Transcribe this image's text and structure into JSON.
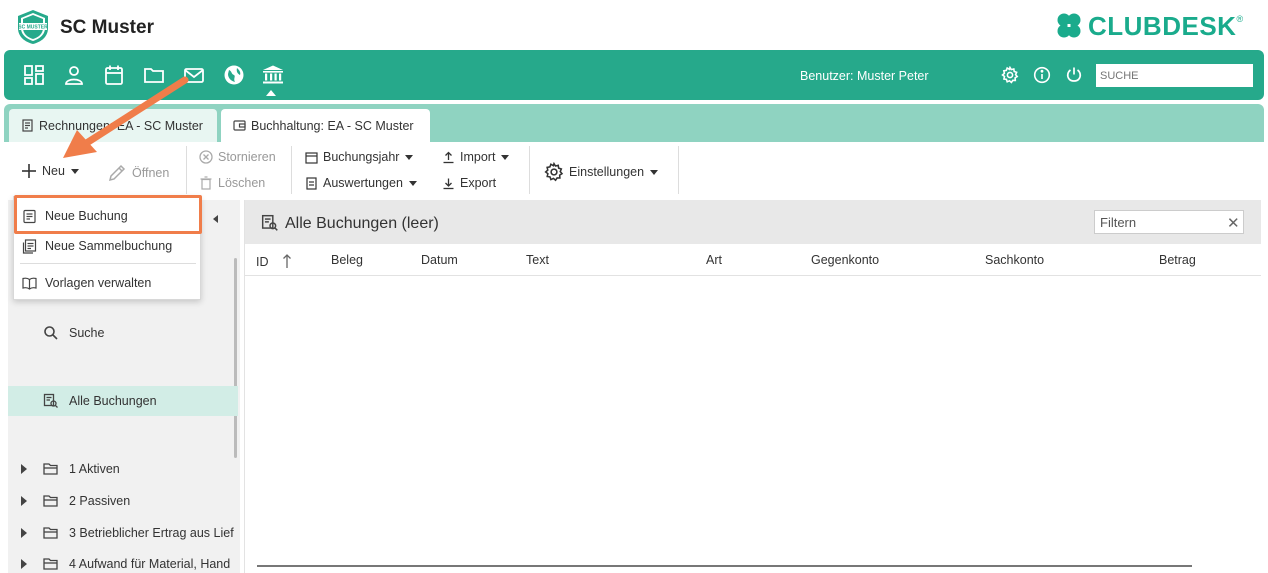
{
  "header": {
    "club_name": "SC Muster",
    "club_logo_text": "SC MUSTER",
    "brand": "CLUBDESK",
    "brand_reg": "®"
  },
  "nav": {
    "icons": [
      "dashboard-icon",
      "person-icon",
      "calendar-icon",
      "folder-icon",
      "mail-icon",
      "globe-icon",
      "bank-icon"
    ],
    "user_label": "Benutzer: Muster Peter",
    "search_placeholder": "SUCHE",
    "right_icons": [
      "gear-icon",
      "info-icon",
      "power-icon"
    ]
  },
  "tabs": [
    {
      "label": "Rechnungen: EA - SC Muster",
      "active": false
    },
    {
      "label": "Buchhaltung: EA - SC Muster",
      "active": true
    }
  ],
  "toolbar": {
    "neu": "Neu",
    "oeffnen": "Öffnen",
    "stornieren": "Stornieren",
    "loeschen": "Löschen",
    "buchungsjahr": "Buchungsjahr",
    "auswertungen": "Auswertungen",
    "import": "Import",
    "export": "Export",
    "einstellungen": "Einstellungen"
  },
  "menu": {
    "items": [
      "Neue Buchung",
      "Neue Sammelbuchung",
      "Vorlagen verwalten"
    ],
    "highlighted": "Neue Buchung"
  },
  "left_panel": {
    "search": "Suche",
    "all_bookings": "Alle Buchungen",
    "folders": [
      "1 Aktiven",
      "2 Passiven",
      "3 Betrieblicher Ertrag aus Lief",
      "4 Aufwand für Material, Hand"
    ]
  },
  "main": {
    "title": "Alle Buchungen (leer)",
    "filter_placeholder": "Filtern",
    "columns": [
      "ID",
      "Beleg",
      "Datum",
      "Text",
      "Art",
      "Gegenkonto",
      "Sachkonto",
      "Betrag"
    ]
  },
  "colors": {
    "accent": "#26a98b",
    "tabstrip": "#8fd3c1",
    "annotation": "#f07d4a",
    "selected": "#d2ede6"
  }
}
